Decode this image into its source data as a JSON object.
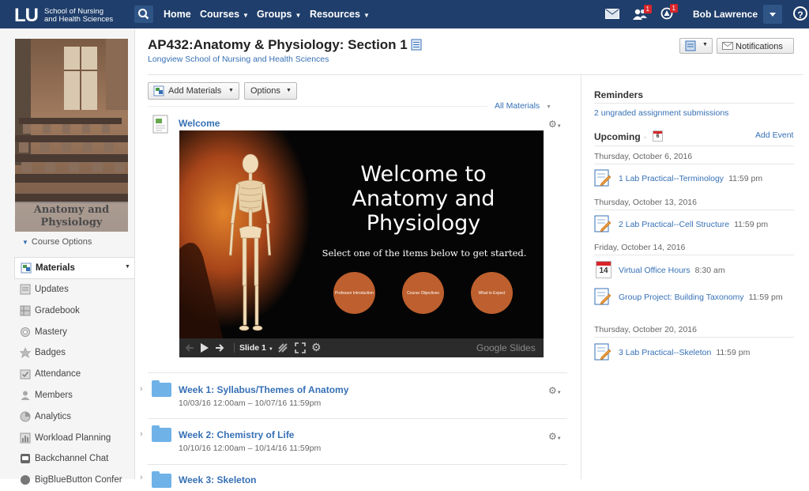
{
  "topnav": {
    "logo_mark": "LU",
    "logo_line1": "School of Nursing",
    "logo_line2": "and Health Sciences",
    "items": [
      {
        "label": "Home"
      },
      {
        "label": "Courses"
      },
      {
        "label": "Groups"
      },
      {
        "label": "Resources"
      }
    ],
    "requests_count": "1",
    "notifications_count": "1",
    "user_name": "Bob Lawrence",
    "help": "?"
  },
  "sidebar": {
    "course_image_label": "Anatomy and Physiology",
    "course_options": "Course Options",
    "items": [
      {
        "label": "Materials"
      },
      {
        "label": "Updates"
      },
      {
        "label": "Gradebook"
      },
      {
        "label": "Mastery"
      },
      {
        "label": "Badges"
      },
      {
        "label": "Attendance"
      },
      {
        "label": "Members"
      },
      {
        "label": "Analytics"
      },
      {
        "label": "Workload Planning"
      },
      {
        "label": "Backchannel Chat"
      },
      {
        "label": "BigBlueButton Confer"
      }
    ]
  },
  "header": {
    "course_title": "AP432:Anatomy & Physiology: Section 1",
    "school": "Longview School of Nursing and Health Sciences",
    "notifications_button": "Notifications"
  },
  "toolbar": {
    "add_materials": "Add Materials",
    "options": "Options",
    "all_materials": "All Materials"
  },
  "materials": {
    "welcome_title": "Welcome",
    "slide": {
      "title": "Welcome to Anatomy and Physiology",
      "subtitle": "Select one of the items below to get started.",
      "circles": [
        "Professor Introduction",
        "Course Objectives",
        "What to Expect"
      ],
      "slide_label": "Slide 1",
      "brand": "Google Slides"
    },
    "folders": [
      {
        "title": "Week 1: Syllabus/Themes of Anatomy",
        "dates": "10/03/16 12:00am – 10/07/16 11:59pm"
      },
      {
        "title": "Week 2: Chemistry of Life",
        "dates": "10/10/16 12:00am – 10/14/16 11:59pm"
      },
      {
        "title": "Week 3: Skeleton",
        "dates": ""
      }
    ]
  },
  "reminders": {
    "heading": "Reminders",
    "link": "2 ungraded assignment submissions"
  },
  "upcoming": {
    "heading": "Upcoming",
    "add_event": "Add Event",
    "calendar_day": "6",
    "groups": [
      {
        "date": "Thursday, October 6, 2016",
        "items": [
          {
            "title": "1 Lab Practical--Terminology",
            "time": "11:59 pm"
          }
        ]
      },
      {
        "date": "Thursday, October 13, 2016",
        "items": [
          {
            "title": "2 Lab Practical--Cell Structure",
            "time": "11:59 pm"
          }
        ]
      },
      {
        "date": "Friday, October 14, 2016",
        "items": [
          {
            "title": "Virtual Office Hours",
            "time": "8:30 am",
            "day": "14"
          },
          {
            "title": "Group Project: Building Taxonomy",
            "time": "11:59 pm"
          }
        ]
      },
      {
        "date": "Thursday, October 20, 2016",
        "items": [
          {
            "title": "3 Lab Practical--Skeleton",
            "time": "11:59 pm"
          }
        ]
      }
    ]
  },
  "colors": {
    "nav_bg": "#1f3e6b",
    "link": "#3670b5",
    "badge": "#d8262a",
    "slide_circle": "#bd5f2e"
  }
}
